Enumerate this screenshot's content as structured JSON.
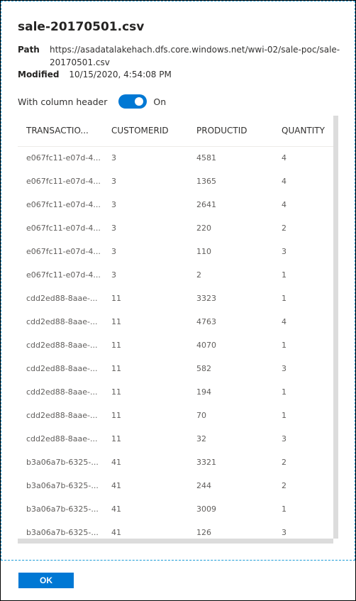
{
  "title": "sale-20170501.csv",
  "path_label": "Path",
  "path_value": "https://asadatalakehach.dfs.core.windows.net/wwi-02/sale-poc/sale-20170501.csv",
  "modified_label": "Modified",
  "modified_value": "10/15/2020, 4:54:08 PM",
  "header_toggle": {
    "label": "With column header",
    "state": "On",
    "on": true,
    "color": "#0078d4"
  },
  "table": {
    "columns": [
      "TRANSACTIO...",
      "CUSTOMERID",
      "PRODUCTID",
      "QUANTITY"
    ],
    "rows": [
      [
        "e067fc11-e07d-4...",
        "3",
        "4581",
        "4"
      ],
      [
        "e067fc11-e07d-4...",
        "3",
        "1365",
        "4"
      ],
      [
        "e067fc11-e07d-4...",
        "3",
        "2641",
        "4"
      ],
      [
        "e067fc11-e07d-4...",
        "3",
        "220",
        "2"
      ],
      [
        "e067fc11-e07d-4...",
        "3",
        "110",
        "3"
      ],
      [
        "e067fc11-e07d-4...",
        "3",
        "2",
        "1"
      ],
      [
        "cdd2ed88-8aae-...",
        "11",
        "3323",
        "1"
      ],
      [
        "cdd2ed88-8aae-...",
        "11",
        "4763",
        "4"
      ],
      [
        "cdd2ed88-8aae-...",
        "11",
        "4070",
        "1"
      ],
      [
        "cdd2ed88-8aae-...",
        "11",
        "582",
        "3"
      ],
      [
        "cdd2ed88-8aae-...",
        "11",
        "194",
        "1"
      ],
      [
        "cdd2ed88-8aae-...",
        "11",
        "70",
        "1"
      ],
      [
        "cdd2ed88-8aae-...",
        "11",
        "32",
        "3"
      ],
      [
        "b3a06a7b-6325-...",
        "41",
        "3321",
        "2"
      ],
      [
        "b3a06a7b-6325-...",
        "41",
        "244",
        "2"
      ],
      [
        "b3a06a7b-6325-...",
        "41",
        "3009",
        "1"
      ],
      [
        "b3a06a7b-6325-...",
        "41",
        "126",
        "3"
      ]
    ]
  },
  "ok_label": "OK"
}
